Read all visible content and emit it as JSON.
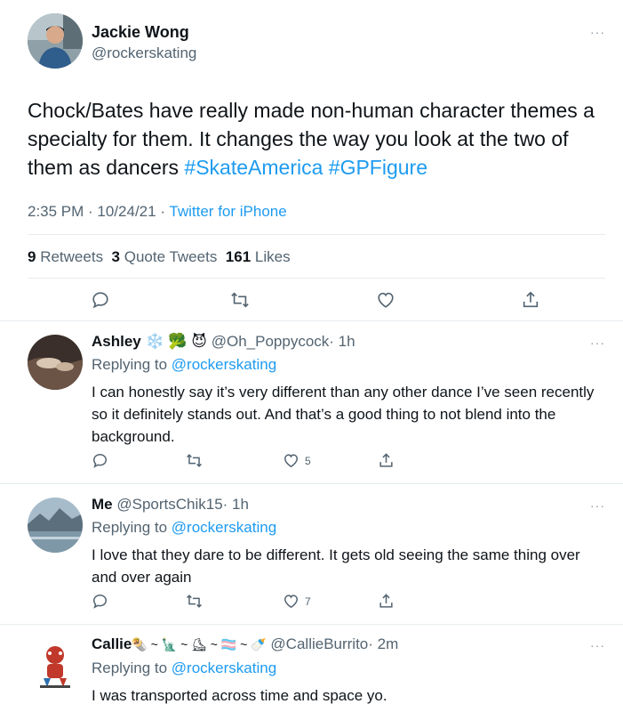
{
  "main_tweet": {
    "name": "Jackie Wong",
    "handle": "@rockerskating",
    "text_plain": "Chock/Bates have really made non-human character themes a specialty for them. It changes the way you look at the two of them as dancers",
    "hashtag1": "#SkateAmerica",
    "hashtag2": "#GPFigure",
    "time": "2:35 PM · 10/24/21 · ",
    "source": "Twitter for iPhone",
    "retweets_count": "9",
    "retweets_label": "Retweets",
    "quotes_count": "3",
    "quotes_label": "Quote Tweets",
    "likes_count": "161",
    "likes_label": "Likes",
    "more": "···"
  },
  "replies": [
    {
      "name": "Ashley",
      "emojis": "❄️ 🥦 😈",
      "handle": "@Oh_Poppycock",
      "time": "· 1h",
      "replying_prefix": "Replying to",
      "replying_to": "@rockerskating",
      "text": "I can honestly say it’s very different than any other dance I’ve seen recently so it definitely stands out. And that’s a good thing to not blend into the background.",
      "like_count": "5",
      "more": "···"
    },
    {
      "name": "Me",
      "handle": "@SportsChik15",
      "time": "· 1h",
      "replying_prefix": "Replying to",
      "replying_to": "@rockerskating",
      "text": "I love that they dare to be different. It gets old seeing the same thing over and over again",
      "like_count": "7",
      "more": "···"
    },
    {
      "name": "Callie",
      "emojis": "🌯 ~ 🗽 ~ ⛸ ~ 🏳️‍⚧️ ~ 🍼",
      "handle": "@CallieBurrito",
      "time": "· 2m",
      "replying_prefix": "Replying to",
      "replying_to": "@rockerskating",
      "text": "I was transported across time and space yo.",
      "more": "···"
    }
  ],
  "icons": [
    "reply-icon",
    "retweet-icon",
    "like-icon",
    "share-icon",
    "more-icon"
  ],
  "colors": {
    "link": "#1d9bf0",
    "muted": "#536471",
    "text": "#0f1419",
    "divider": "#e6ecf0"
  }
}
